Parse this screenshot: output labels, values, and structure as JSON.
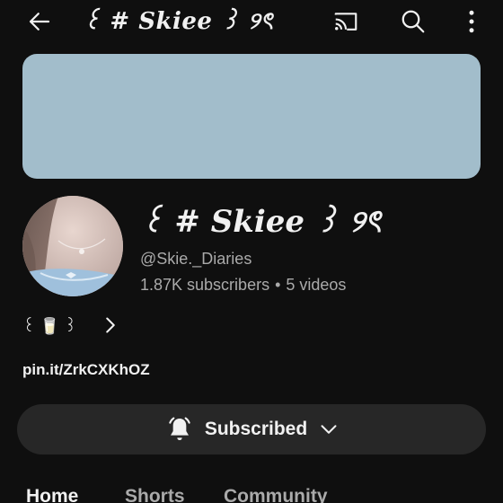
{
  "header": {
    "title": "꒰ # Skiee ꒱ ୨ৎ"
  },
  "channel": {
    "name": "꒰ # Skiee ꒱ ୨ৎ",
    "handle": "@Skie._Diaries",
    "subscribers": "1.87K subscribers",
    "separator": "•",
    "videos": "5 videos",
    "description": "꒰ 🥛 ꒱",
    "link": "pin.it/ZrkCXKhOZ"
  },
  "subscribe": {
    "label": "Subscribed"
  },
  "tabs": [
    {
      "label": "Home",
      "selected": true
    },
    {
      "label": "Shorts",
      "selected": false
    },
    {
      "label": "Community",
      "selected": false
    }
  ],
  "colors": {
    "background": "#0f0f0f",
    "banner": "#a2bdcb",
    "button": "#272727",
    "secondary_text": "#aaaaaa"
  },
  "icons": [
    "back-arrow-icon",
    "cast-icon",
    "search-icon",
    "more-vert-icon",
    "chevron-right-icon",
    "bell-icon",
    "chevron-down-icon"
  ]
}
